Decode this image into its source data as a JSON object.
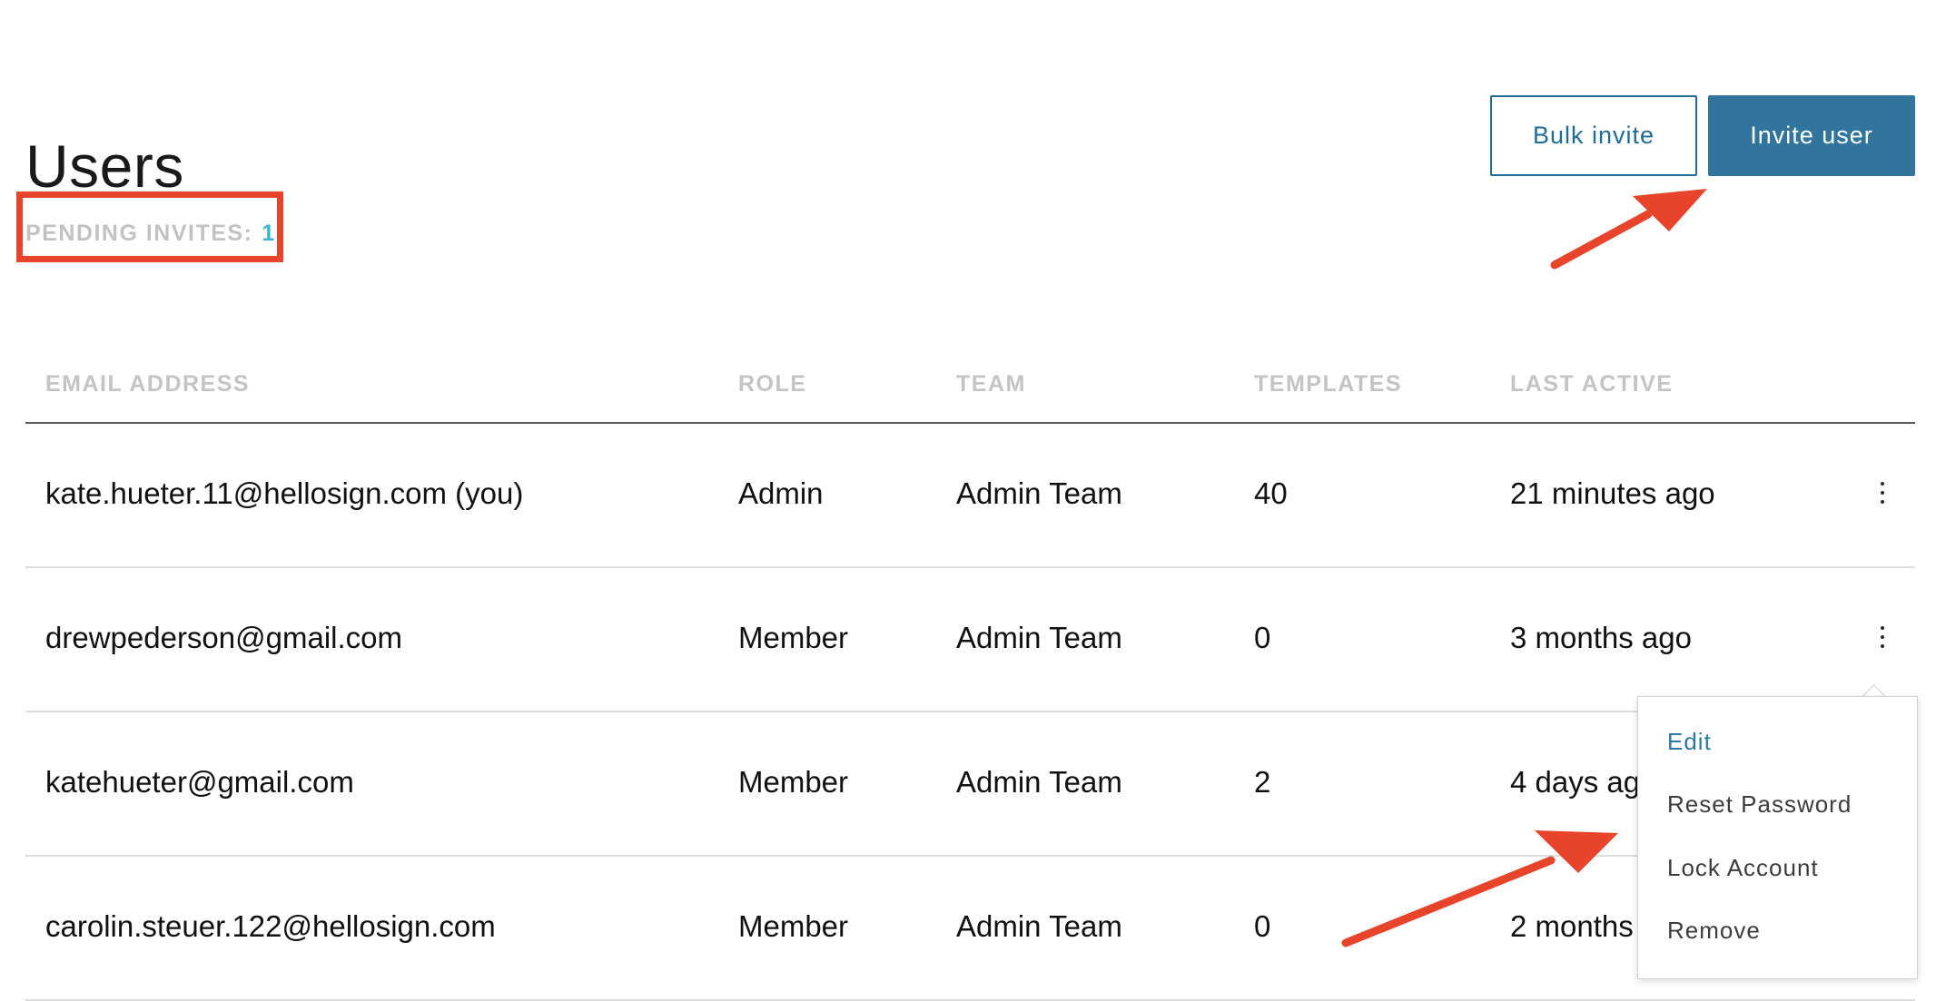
{
  "header": {
    "title": "Users",
    "pending_label": "PENDING INVITES:",
    "pending_count": "1"
  },
  "actions": {
    "bulk_invite": "Bulk invite",
    "invite_user": "Invite user"
  },
  "table": {
    "columns": [
      "EMAIL ADDRESS",
      "ROLE",
      "TEAM",
      "TEMPLATES",
      "LAST ACTIVE"
    ],
    "rows": [
      {
        "email": "kate.hueter.11@hellosign.com (you)",
        "role": "Admin",
        "team": "Admin Team",
        "templates": "40",
        "last_active": "21 minutes ago"
      },
      {
        "email": "drewpederson@gmail.com",
        "role": "Member",
        "team": "Admin Team",
        "templates": "0",
        "last_active": "3 months ago"
      },
      {
        "email": "katehueter@gmail.com",
        "role": "Member",
        "team": "Admin Team",
        "templates": "2",
        "last_active": "4 days ago"
      },
      {
        "email": "carolin.steuer.122@hellosign.com",
        "role": "Member",
        "team": "Admin Team",
        "templates": "0",
        "last_active": "2 months ago"
      }
    ]
  },
  "row_menu": {
    "items": [
      "Edit",
      "Reset Password",
      "Lock Account",
      "Remove"
    ]
  },
  "annotations": {
    "color": "#e8432b"
  },
  "colors": {
    "primary": "#32759c",
    "link": "#2a78a3",
    "pending_count": "#3bb3d8"
  }
}
